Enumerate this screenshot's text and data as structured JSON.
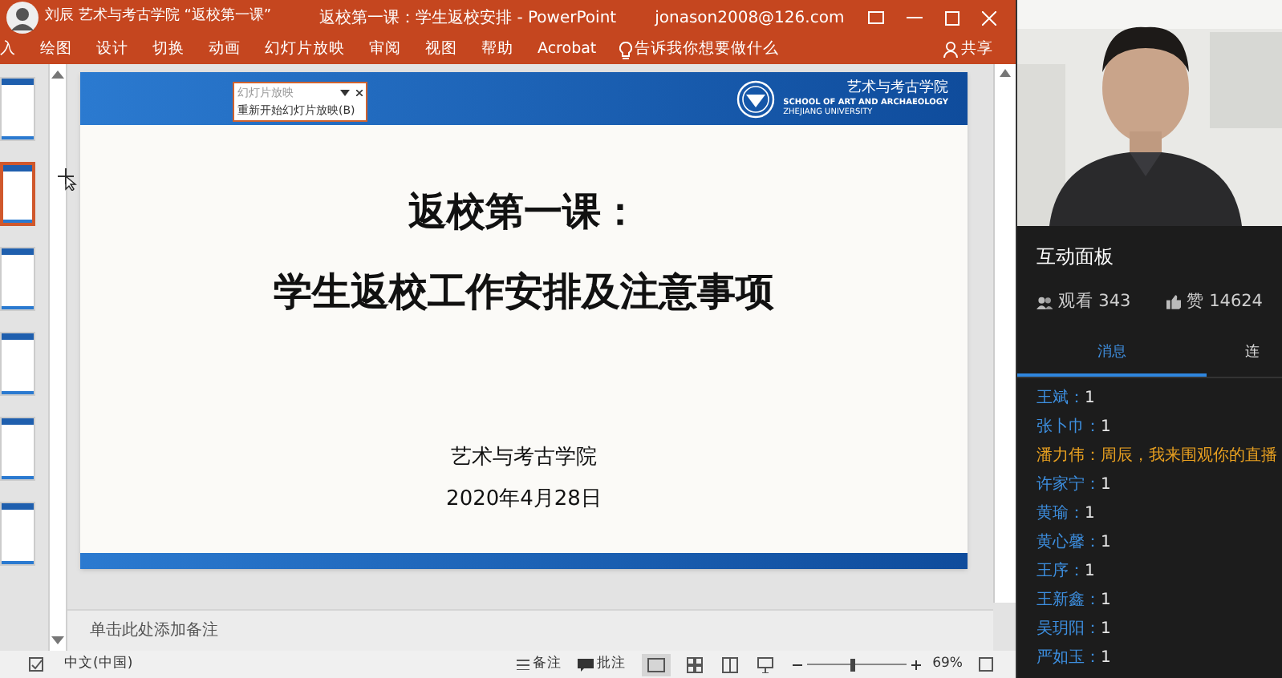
{
  "title_bar": {
    "overlay_label": "刘辰 艺术与考古学院 “返校第一课”",
    "title": "返校第一课：学生返校安排  -  PowerPoint",
    "account": "jonason2008@126.com"
  },
  "ribbon": {
    "tabs": [
      {
        "label": "入",
        "selected": false
      },
      {
        "label": "绘图",
        "selected": false
      },
      {
        "label": "设计",
        "selected": false
      },
      {
        "label": "切换",
        "selected": false
      },
      {
        "label": "动画",
        "selected": false
      },
      {
        "label": "幻灯片放映",
        "selected": false
      },
      {
        "label": "审阅",
        "selected": false
      },
      {
        "label": "视图",
        "selected": false
      },
      {
        "label": "帮助",
        "selected": false
      },
      {
        "label": "Acrobat",
        "selected": false
      }
    ],
    "tell_me": "告诉我你想要做什么",
    "share": "共享"
  },
  "thumbnails": [
    {
      "selected": false
    },
    {
      "selected": true
    },
    {
      "selected": false
    },
    {
      "selected": false
    },
    {
      "selected": false
    },
    {
      "selected": false
    }
  ],
  "popup": {
    "title": "幻灯片放映",
    "item": "重新开始幻灯片放映(B)"
  },
  "slide": {
    "school_cn": "艺术与考古学院",
    "school_en": "SCHOOL OF ART AND ARCHAEOLOGY",
    "university_en": "ZHEJIANG UNIVERSITY",
    "title_lines": [
      "返校第一课：",
      "学生返校工作安排及注意事项"
    ],
    "organizer": "艺术与考古学院",
    "date": "2020年4月28日"
  },
  "notes": {
    "placeholder": "单击此处添加备注"
  },
  "status_bar": {
    "language": "中文(中国)",
    "notes": "备注",
    "comments": "批注",
    "zoom": "69%",
    "zoom_slider": {
      "level": 0.45
    }
  },
  "panel": {
    "title": "互动面板",
    "viewers": "观看 343",
    "likes": "赞 14624",
    "tabs": [
      {
        "label": "消息",
        "selected": true
      },
      {
        "label": "连",
        "selected": false
      }
    ],
    "messages": [
      {
        "name": "王斌：",
        "text": "1",
        "kind": "normal"
      },
      {
        "name": "张卜巾：",
        "text": "1",
        "kind": "normal"
      },
      {
        "name": "潘力伟：",
        "text": "周辰，我来围观你的直播",
        "kind": "highlight"
      },
      {
        "name": "许家宁：",
        "text": "1",
        "kind": "normal"
      },
      {
        "name": "黄瑜：",
        "text": "1",
        "kind": "normal"
      },
      {
        "name": "黄心馨：",
        "text": "1",
        "kind": "normal"
      },
      {
        "name": "王序：",
        "text": "1",
        "kind": "normal"
      },
      {
        "name": "王新鑫：",
        "text": "1",
        "kind": "normal"
      },
      {
        "name": "吴玥阳：",
        "text": "1",
        "kind": "normal"
      },
      {
        "name": "严如玉：",
        "text": "1",
        "kind": "normal"
      }
    ]
  }
}
